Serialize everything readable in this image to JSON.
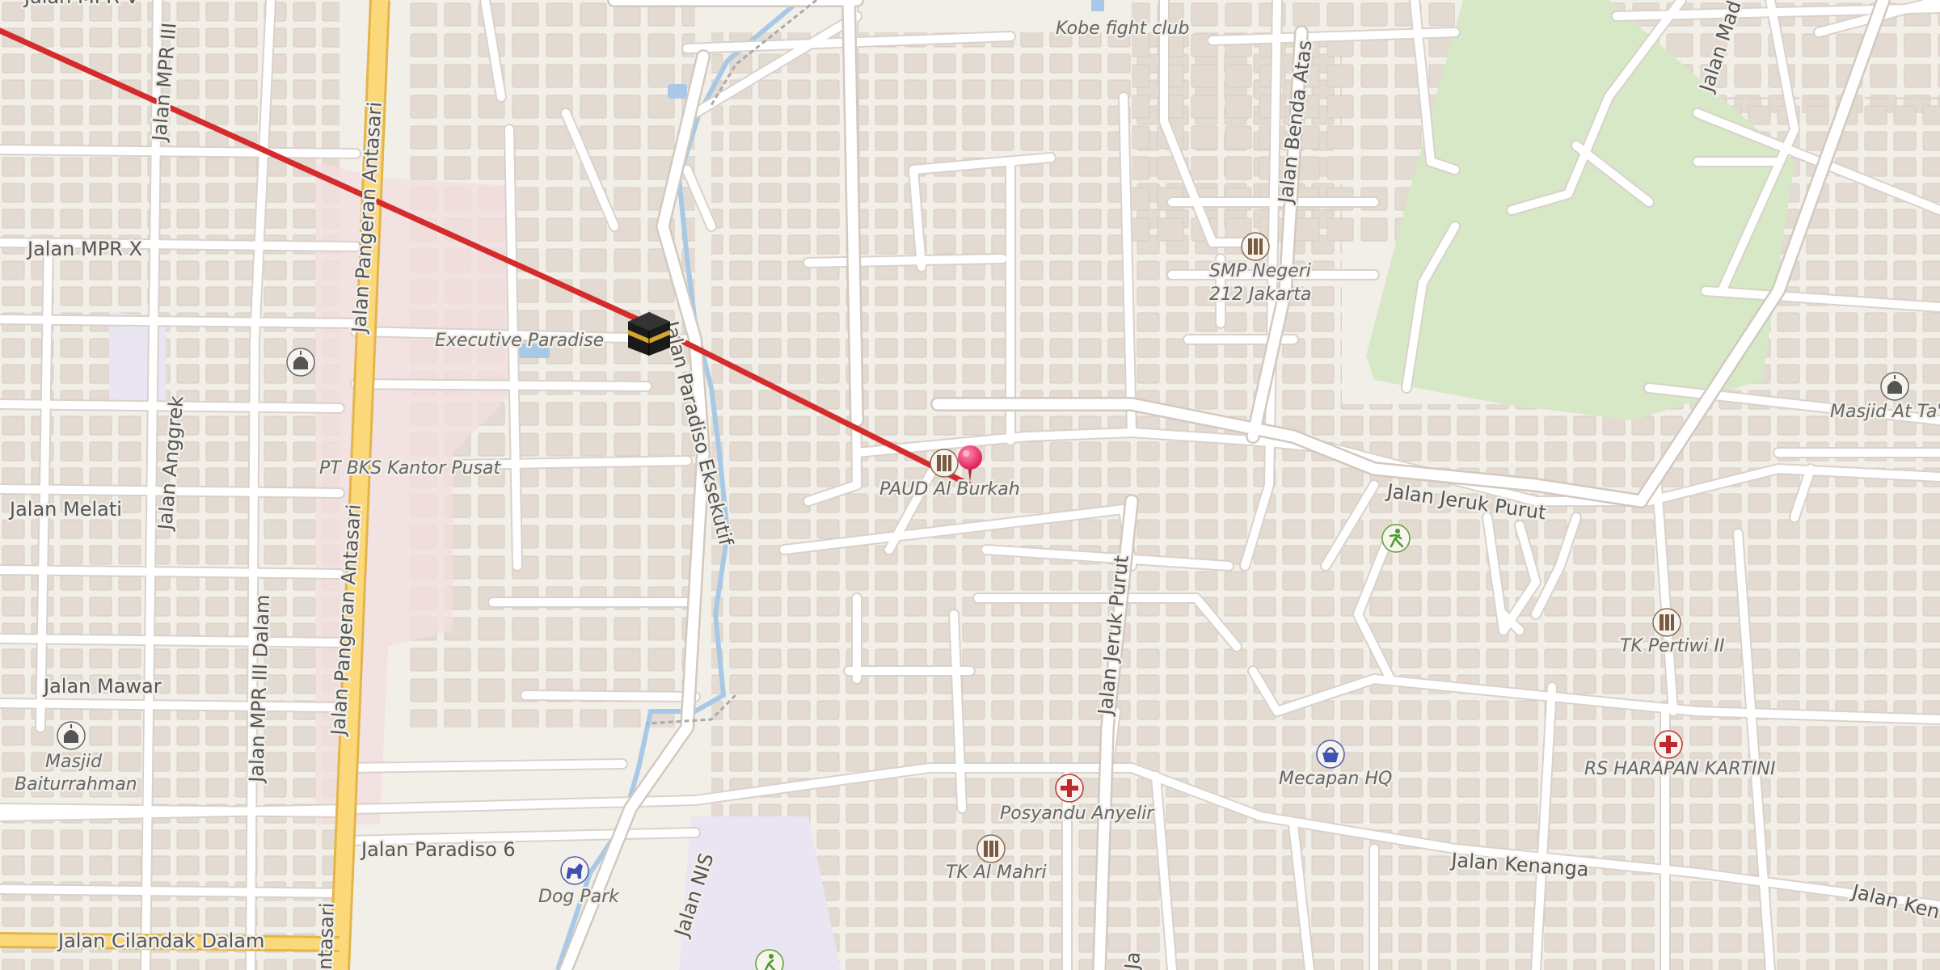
{
  "colors": {
    "land": "#f2efe9",
    "building": "#e1d9d0",
    "road": "#ffffff",
    "road_casing": "#d9d2ca",
    "primary_road": "#fbd97a",
    "primary_casing": "#e3b54a",
    "park": "#d6e8c6",
    "school_area": "#e9e5f2",
    "commercial_area": "#f1dede",
    "water": "#a8c9e6",
    "route_line": "#d42c2c",
    "pin": "#e8336b"
  },
  "street_labels": {
    "mpr_iii": "Jalan MPR III",
    "mpr_x": "Jalan MPR X",
    "melati": "Jalan Melati",
    "mawar": "Jalan Mawar",
    "anggrek": "Jalan Anggrek",
    "mpr_iii_dalam": "Jalan MPR III Dalam",
    "antasari_top": "Jalan Pangeran Antasari",
    "antasari_bottom": "Jalan Pangeran Antasari",
    "antasari_edge": "ntasari",
    "paradiso_eksekutif": "Jalan Paradiso Eksekutif",
    "paradiso_6": "Jalan Paradiso 6",
    "cilandak_dalam": "Jalan Cilandak Dalam",
    "nis": "Jalan NIS",
    "benda_atas": "Jalan Benda Atas",
    "jeruk_purut_h": "Jalan Jeruk Purut",
    "jeruk_purut_v": "Jalan Jeruk Purut",
    "kenanga": "Jalan Kenanga",
    "kenanga_edge": "Jalan Ken",
    "mad_edge": "Jalan Mad",
    "top_edge": "Jalan MPR V",
    "bottom_edge_ja": "Ja"
  },
  "poi_labels": {
    "kobe": "Kobe fight club",
    "smp_1": "SMP Negeri",
    "smp_2": "212 Jakarta",
    "executive_paradise": "Executive Paradise",
    "pt_bks": "PT BKS Kantor Pusat",
    "paud": "PAUD Al Burkah",
    "masjid_at": "Masjid At Ta'l",
    "tk_pertiwi": "TK Pertiwi II",
    "rs_harapan": "RS HARAPAN KARTINI",
    "mecapan": "Mecapan HQ",
    "posyandu": "Posyandu Anyelir",
    "tk_almahri": "TK Al Mahri",
    "dog_park": "Dog Park",
    "masjid_1": "Masjid",
    "masjid_2": "Baiturrahman"
  },
  "icons": {
    "kaaba": "kaaba-marker-icon",
    "pin": "location-pin-icon",
    "school": "school-icon",
    "mosque": "mosque-icon",
    "hospital": "hospital-cross-icon",
    "shop": "shop-basket-icon",
    "dog_park": "dog-park-icon",
    "sport": "sport-runner-icon"
  }
}
